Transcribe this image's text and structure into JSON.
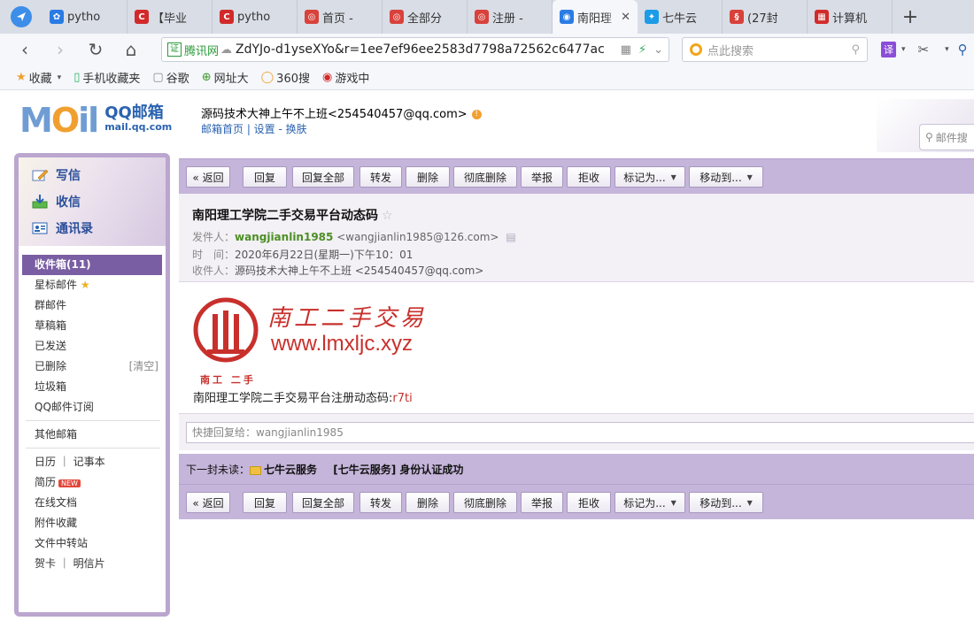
{
  "tabs": [
    {
      "title": "pytho",
      "fav_color": "#2a7be4",
      "fav_glyph": "✿"
    },
    {
      "title": "【毕业",
      "fav_color": "#d22a2a",
      "fav_glyph": "C"
    },
    {
      "title": "pytho",
      "fav_color": "#d22a2a",
      "fav_glyph": "C"
    },
    {
      "title": "首页 -",
      "fav_color": "#d9413b",
      "fav_glyph": "◎"
    },
    {
      "title": "全部分",
      "fav_color": "#d9413b",
      "fav_glyph": "◎"
    },
    {
      "title": "注册 -",
      "fav_color": "#d9413b",
      "fav_glyph": "◎"
    },
    {
      "title": "南阳理",
      "fav_color": "#2a7be4",
      "fav_glyph": "◉",
      "active": true
    },
    {
      "title": "七牛云",
      "fav_color": "#1c9be6",
      "fav_glyph": "✦"
    },
    {
      "title": "(27封",
      "fav_color": "#d9413b",
      "fav_glyph": "§"
    },
    {
      "title": "计算机",
      "fav_color": "#d22a2a",
      "fav_glyph": "▦"
    }
  ],
  "address": {
    "cert_label": "证",
    "site_label": "腾讯网",
    "url": "ZdYJo-d1yseXYo&r=1ee7ef96ee2583d7798a72562c6477ac"
  },
  "search": {
    "placeholder": "点此搜索"
  },
  "toolbar": {
    "translate": "译"
  },
  "bookmarks": [
    {
      "label": "收藏",
      "icon": "star-icon"
    },
    {
      "label": "手机收藏夹",
      "icon": "phone-icon"
    },
    {
      "label": "谷歌",
      "icon": "page-icon"
    },
    {
      "label": "网址大",
      "icon": "compass-icon"
    },
    {
      "label": "360搜",
      "icon": "circle-icon"
    },
    {
      "label": "游戏中",
      "icon": "game-icon"
    }
  ],
  "mail": {
    "logo_text": "QQ邮箱",
    "logo_url": "mail.qq.com",
    "user_line": "源码技术大神上午不上班<254540457@qq.com>",
    "links": "邮箱首页 | 设置 - 换肤",
    "search_placeholder": "邮件搜",
    "compose": "写信",
    "inbox": "收信",
    "contacts": "通讯录",
    "folders": {
      "inbox": "收件箱(11)",
      "starred": "星标邮件",
      "group": "群邮件",
      "drafts": "草稿箱",
      "sent": "已发送",
      "deleted": "已删除",
      "deleted_clear": "[清空]",
      "trash": "垃圾箱",
      "subscribe": "QQ邮件订阅",
      "other": "其他邮箱",
      "calendar": "日历 ｜ 记事本",
      "resume": "简历",
      "new_tag": "NEW",
      "docs": "在线文档",
      "attachments": "附件收藏",
      "transfer": "文件中转站",
      "cards": "贺卡 ｜ 明信片"
    },
    "actions": {
      "back": "« 返回",
      "reply": "回复",
      "reply_all": "回复全部",
      "forward": "转发",
      "delete": "删除",
      "delete_forever": "彻底删除",
      "report": "举报",
      "reject": "拒收",
      "mark_as": "标记为...",
      "move_to": "移动到..."
    },
    "message": {
      "subject": "南阳理工学院二手交易平台动态码",
      "from_label": "发件人：",
      "from_name": "wangjianlin1985",
      "from_email": "<wangjianlin1985@126.com>",
      "time_label": "时　间：",
      "time_value": "2020年6月22日(星期一)下午10：01",
      "to_label": "收件人：",
      "to_value": "源码技术大神上午不上班 <254540457@qq.com>",
      "brand_cn": "南工二手交易",
      "brand_url": "www.lmxljc.xyz",
      "stamp_caption": "南工 二手",
      "body_text": "南阳理工学院二手交易平台注册动态码:",
      "code": "r7ti"
    },
    "quick_reply": "快捷回复给：wangjianlin1985",
    "next_label": "下一封未读：",
    "next_sender": "七牛云服务",
    "next_subject": "[七牛云服务] 身份认证成功"
  },
  "colors": {
    "accent_purple": "#c5b5da",
    "selected_folder": "#7a5ea3",
    "brand_red": "#c8302c",
    "sender_green": "#4c8f24"
  }
}
